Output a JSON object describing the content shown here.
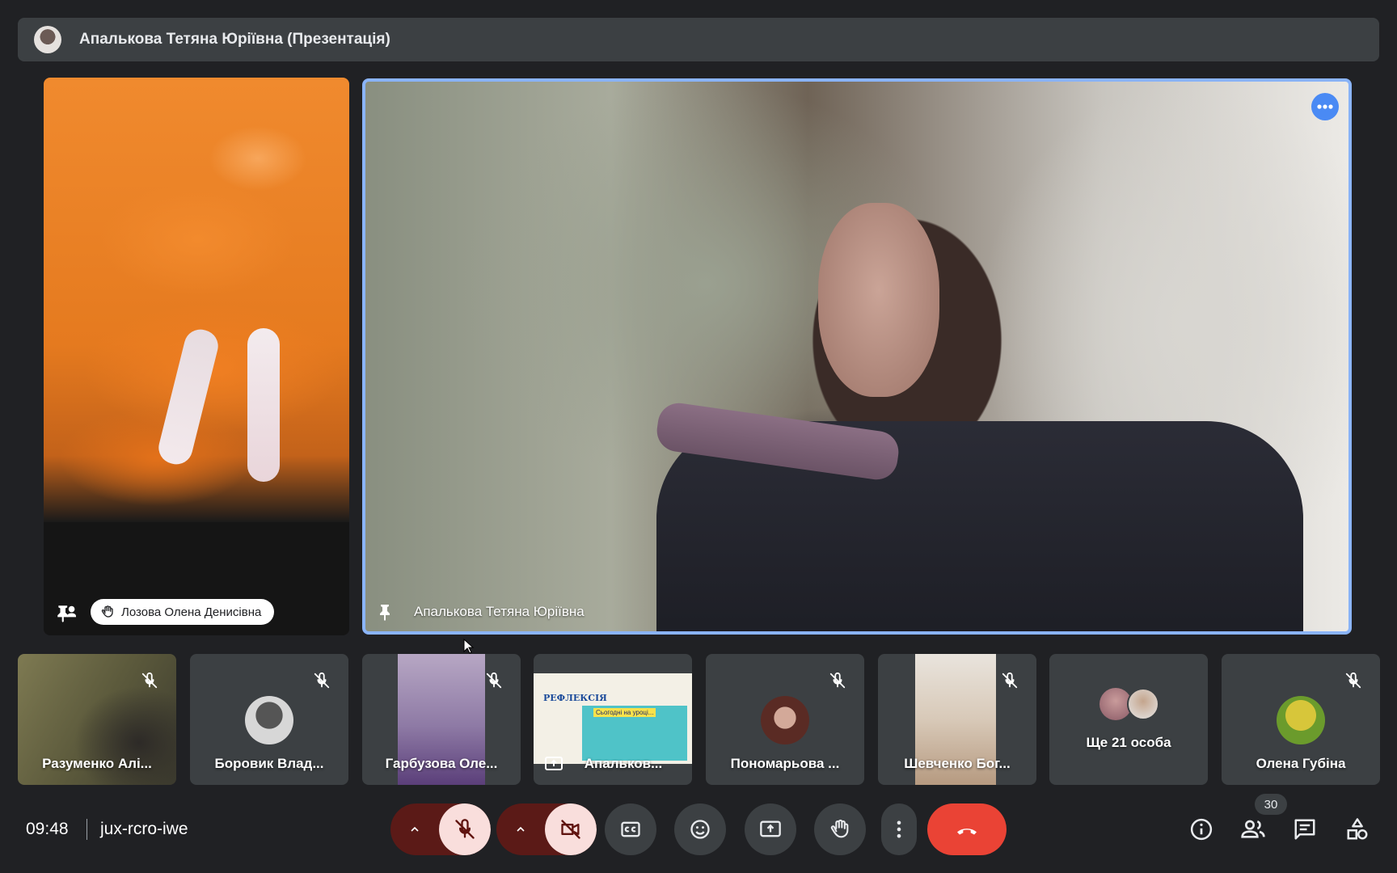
{
  "banner": {
    "title": "Апалькова Тетяна Юріївна (Презентація)"
  },
  "tiles": {
    "left": {
      "name": "Лозова Олена Денисівна"
    },
    "main": {
      "name": "Апалькова Тетяна Юріївна"
    }
  },
  "filmstrip": [
    {
      "name": "Разуменко Алі...",
      "muted": true
    },
    {
      "name": "Боровик Влад...",
      "muted": true
    },
    {
      "name": "Гарбузова Оле...",
      "muted": true
    },
    {
      "name": "Апальков...",
      "muted": false,
      "presenting": true
    },
    {
      "name": "Пономарьова ...",
      "muted": true
    },
    {
      "name": "Шевченко Бог...",
      "muted": true
    },
    {
      "name": "Ще 21 особа",
      "muted": false
    },
    {
      "name": "Олена Губіна",
      "muted": true
    }
  ],
  "slide": {
    "title": "РЕФЛЕКСІЯ",
    "subtitle": "Сьогодні на уроці..."
  },
  "bottom_bar": {
    "time": "09:48",
    "meeting_code": "jux-rcro-iwe",
    "people_count": "30"
  },
  "colors": {
    "accent": "#8ab4f8",
    "leave": "#ea4335",
    "background": "#202124",
    "surface": "#3c4043"
  },
  "icons": [
    "mic-off-icon",
    "videocam-off-icon",
    "closed-caption-icon",
    "emoji-icon",
    "present-icon",
    "raise-hand-icon",
    "more-vert-icon",
    "call-end-icon",
    "info-icon",
    "people-icon",
    "chat-icon",
    "activities-icon",
    "pin-icon"
  ]
}
